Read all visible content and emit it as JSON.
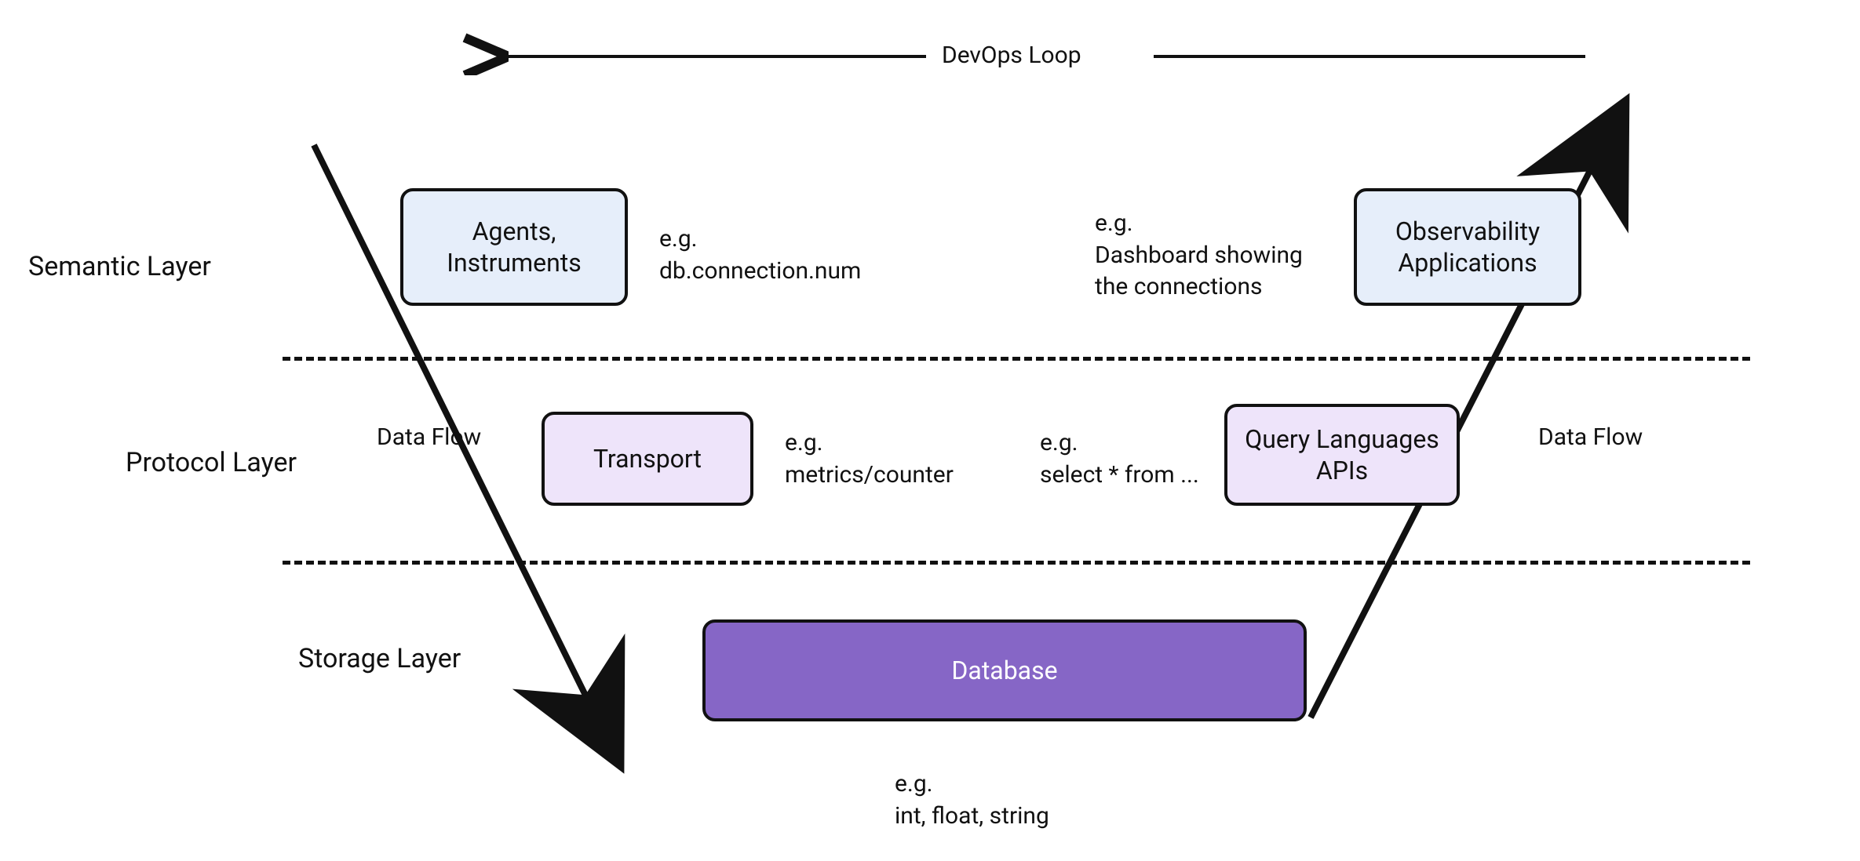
{
  "loop_label": "DevOps Loop",
  "dataflow_left_label": "Data Flow",
  "dataflow_right_label": "Data Flow",
  "layers": {
    "semantic": {
      "label": "Semantic Layer",
      "left_box": "Agents,\nInstruments",
      "left_eg": "e.g.\ndb.connection.num",
      "right_eg": "e.g.\nDashboard showing\nthe connections",
      "right_box": "Observability\nApplications"
    },
    "protocol": {
      "label": "Protocol Layer",
      "left_box": "Transport",
      "left_eg": "e.g.\nmetrics/counter",
      "right_eg": "e.g.\nselect * from ...",
      "right_box": "Query Languages\nAPIs"
    },
    "storage": {
      "label": "Storage Layer",
      "center_box": "Database",
      "center_eg": "e.g.\nint, float, string"
    }
  },
  "colors": {
    "blue": "#e6eefa",
    "lilac": "#eee4fa",
    "purple": "#8666c6",
    "ink": "#111111"
  }
}
